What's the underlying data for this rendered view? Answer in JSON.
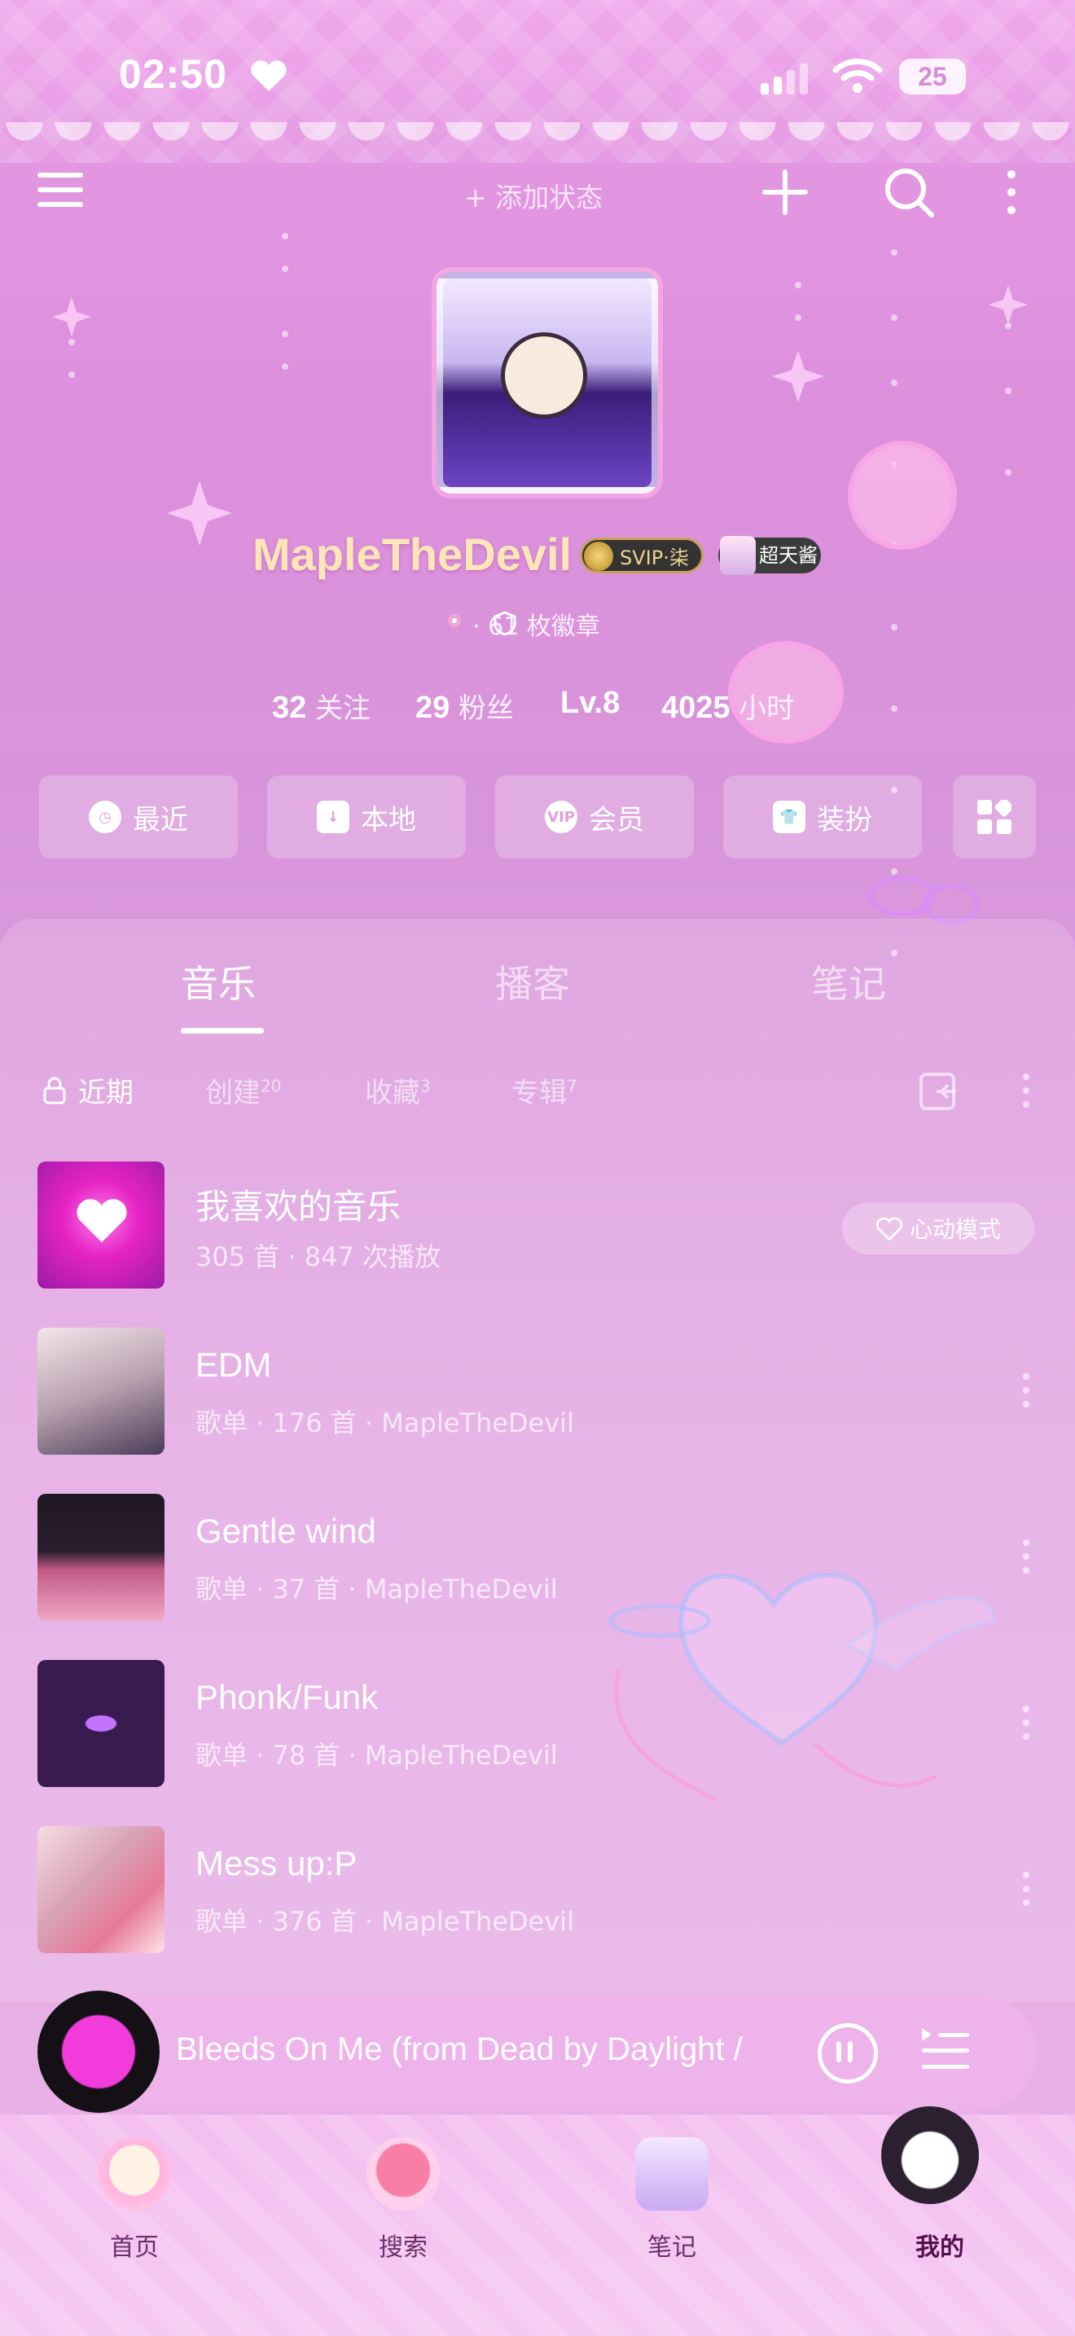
{
  "status_bar": {
    "time": "02:50",
    "battery": "25"
  },
  "header": {
    "add_status": "+ 添加状态"
  },
  "profile": {
    "username": "MapleTheDevil",
    "svip_label": "SVIP·柒",
    "badge_label": "超天酱",
    "badges_text": "· 61 枚徽章",
    "stats": [
      {
        "value": "32",
        "label": "关注"
      },
      {
        "value": "29",
        "label": "粉丝"
      },
      {
        "value": "Lv.8",
        "label": ""
      },
      {
        "value": "4025",
        "label": "小时"
      }
    ]
  },
  "quick_actions": [
    {
      "label": "最近",
      "icon": "clock-icon"
    },
    {
      "label": "本地",
      "icon": "download-icon"
    },
    {
      "label": "会员",
      "icon": "vip-icon"
    },
    {
      "label": "装扮",
      "icon": "shirt-icon"
    }
  ],
  "tabs": [
    "音乐",
    "播客",
    "笔记"
  ],
  "subtabs": [
    {
      "label": "近期",
      "count": ""
    },
    {
      "label": "创建",
      "count": "20"
    },
    {
      "label": "收藏",
      "count": "3"
    },
    {
      "label": "专辑",
      "count": "7"
    }
  ],
  "playlists": [
    {
      "title": "我喜欢的音乐",
      "subtitle": "305 首 · 847 次播放",
      "cover_color": "#e623c4"
    },
    {
      "title": "EDM",
      "subtitle": "歌单 · 176 首 · MapleTheDevil",
      "cover_color": "#d8cbd6"
    },
    {
      "title": "Gentle wind",
      "subtitle": "歌单 · 37 首 · MapleTheDevil",
      "cover_color": "#2a1d2d"
    },
    {
      "title": "Phonk/Funk",
      "subtitle": "歌单 · 78 首 · MapleTheDevil",
      "cover_color": "#3a1b50"
    },
    {
      "title": "Mess up:P",
      "subtitle": "歌单 · 376 首 · MapleTheDevil",
      "cover_color": "#d9a4b7"
    }
  ],
  "heart_mode": "心动模式",
  "player": {
    "song": "Bleeds On Me (from Dead by Daylight /"
  },
  "nav": [
    {
      "label": "首页",
      "active": false
    },
    {
      "label": "搜索",
      "active": false
    },
    {
      "label": "笔记",
      "active": false
    },
    {
      "label": "我的",
      "active": true
    }
  ]
}
